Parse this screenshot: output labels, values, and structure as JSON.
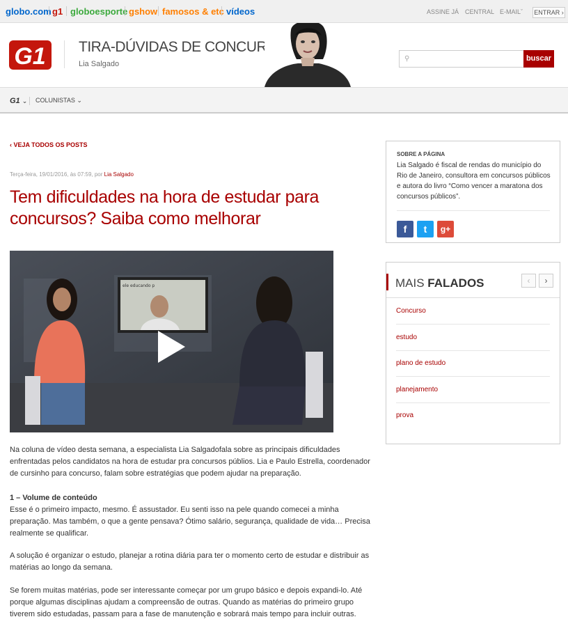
{
  "topbar": {
    "sites": [
      {
        "label": "globo.com",
        "color": "#0066cc"
      },
      {
        "label": "g1",
        "color": "#c4170c"
      },
      {
        "label": "globoesporte",
        "color": "#3ba93c"
      },
      {
        "label": "gshow",
        "color": "#ff7f00"
      },
      {
        "label": "famosos & etc",
        "color": "#ff7f00"
      },
      {
        "label": "vídeos",
        "color": "#0066cc"
      }
    ],
    "links": [
      "ASSINE JÁ",
      "CENTRAL",
      "E-MAIL"
    ],
    "login": "ENTRAR"
  },
  "header": {
    "blog_title": "TIRA-DÚVIDAS DE CONCURSOS",
    "author": "Lia Salgado",
    "search_button": "buscar",
    "search_placeholder": ""
  },
  "nav": {
    "brand": "G1",
    "columnists": "COLUNISTAS"
  },
  "post": {
    "back_link": "VEJA TODOS OS POSTS",
    "date": "Terça-feira, 19/01/2016, às 07:59, por",
    "author": "Lia Salgado",
    "title": "Tem dificuldades na hora de estudar para concursos? Saiba como melhorar",
    "video_screen_text": "ele educando p",
    "paragraphs": [
      "Na coluna de vídeo desta semana, a especialista Lia Salgadofala sobre as principais dificuldades enfrentadas pelos candidatos na hora de estudar pra concursos públios. Lia e Paulo Estrella, coordenador de cursinho para concurso, falam sobre estratégias que podem ajudar na preparação.",
      "Esse é o primeiro impacto, mesmo. É assustador. Eu senti isso na pele quando comecei a minha preparação. Mas também, o que a gente pensava? Ótimo salário, segurança, qualidade de vida… Precisa realmente se qualificar.",
      "A solução é organizar o estudo, planejar a rotina diária para ter o momento certo de estudar e distribuir as matérias ao longo da semana.",
      "Se forem muitas matérias, pode ser interessante começar por um grupo básico e depois expandi-lo. Até porque algumas disciplinas ajudam a compreensão de outras. Quando as matérias do primeiro grupo tiverem sido estudadas, passam para a fase de manutenção e sobrará mais tempo para incluir outras."
    ],
    "heading_1": "1 – Volume de conteúdo"
  },
  "about": {
    "heading": "SOBRE A PÁGINA",
    "text": "Lia Salgado é fiscal de rendas do município do Rio de Janeiro, consultora em concursos públicos e autora do livro “Como vencer a maratona dos concursos públicos”.",
    "social": [
      {
        "name": "facebook",
        "glyph": "f",
        "color": "#3b5998"
      },
      {
        "name": "twitter",
        "glyph": "t",
        "color": "#1da1f2"
      },
      {
        "name": "googleplus",
        "glyph": "g+",
        "color": "#dd4b39"
      }
    ]
  },
  "mais_falados": {
    "heading_light": "MAIS",
    "heading_bold": "FALADOS",
    "prev": "‹",
    "next": "›",
    "items": [
      "Concurso",
      "estudo",
      "plano de estudo",
      "planejamento",
      "prova"
    ]
  }
}
